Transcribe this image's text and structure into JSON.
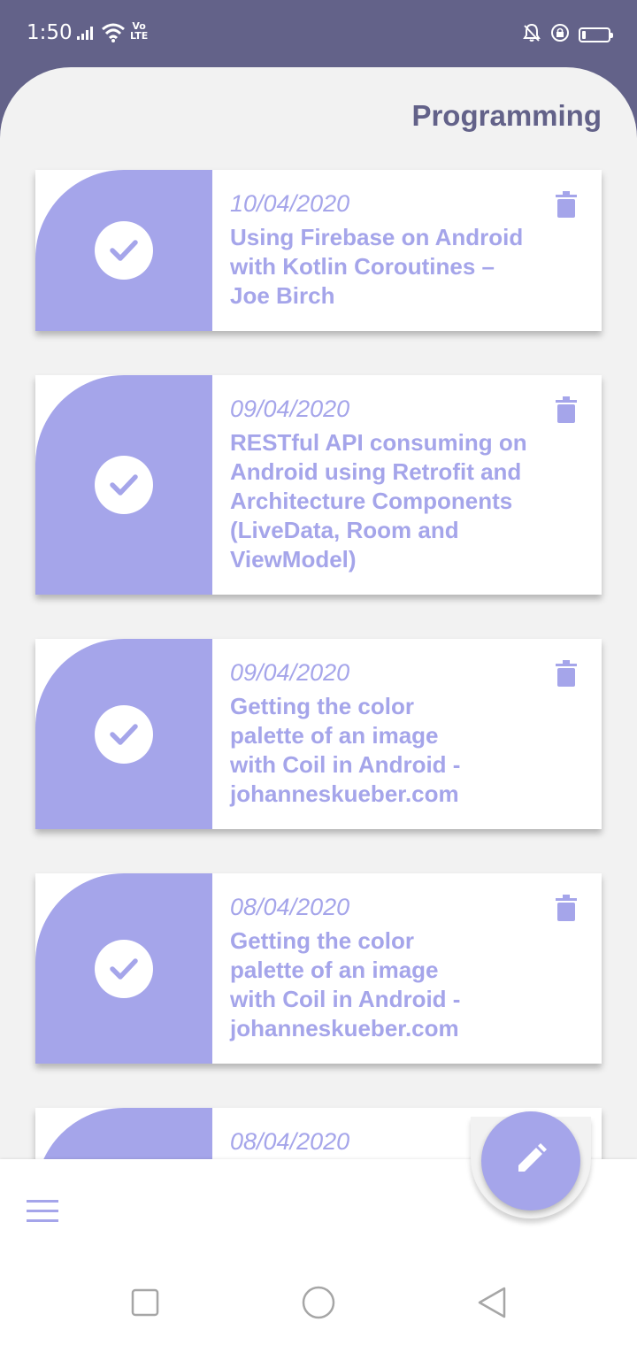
{
  "status_bar": {
    "time": "1:50",
    "volte_top": "Vo",
    "volte_bottom": "LTE",
    "icons": [
      "signal-icon",
      "wifi-icon",
      "volte-icon",
      "bell-off-icon",
      "lock-rotation-icon",
      "battery-icon"
    ],
    "battery_level": 0.15
  },
  "header": {
    "title": "Programming"
  },
  "notes": [
    {
      "date": "10/04/2020",
      "text": "Using Firebase on Android with Kotlin Coroutines – Joe Birch"
    },
    {
      "date": "09/04/2020",
      "text": "RESTful API consuming on Android using Retrofit and Architecture Components (LiveData, Room and ViewModel)"
    },
    {
      "date": "09/04/2020",
      "text": "Getting the color palette of an image with Coil in Android - johanneskueber.com"
    },
    {
      "date": "08/04/2020",
      "text": "Getting the color palette of an image with Coil in Android - johanneskueber.com"
    },
    {
      "date": "08/04/2020",
      "text": ""
    }
  ],
  "bottom_bar": {
    "menu_icon": "menu-icon",
    "fab_icon": "edit-icon"
  },
  "nav": [
    "recents-icon",
    "home-icon",
    "back-icon"
  ],
  "colors": {
    "accent": "#a5a5ea",
    "status_bar": "#636289",
    "background": "#f2f2f2",
    "title": "#636289"
  }
}
